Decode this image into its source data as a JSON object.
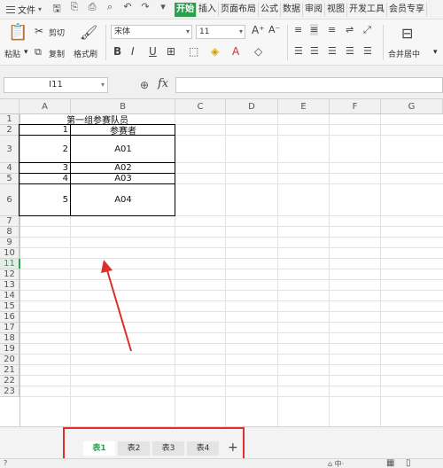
{
  "menubar": {
    "file_label": "文件",
    "tabs": [
      "开始",
      "插入",
      "页面布局",
      "公式",
      "数据",
      "审阅",
      "视图",
      "开发工具",
      "会员专享"
    ],
    "active_tab": "开始"
  },
  "ribbon": {
    "paste": "粘贴",
    "cut": "剪切",
    "copy": "复制",
    "format_painter": "格式刷",
    "font_name": "宋体",
    "font_size": "11",
    "merge_center": "合并居中"
  },
  "formula_bar": {
    "cell_ref": "I11",
    "fx": "fx",
    "formula": ""
  },
  "grid": {
    "columns": [
      "A",
      "B",
      "C",
      "D",
      "E",
      "F",
      "G"
    ],
    "rows": [
      "1",
      "2",
      "3",
      "4",
      "5",
      "6",
      "7",
      "8",
      "9",
      "10",
      "11",
      "12",
      "13",
      "14",
      "15",
      "16",
      "17",
      "18",
      "19",
      "20",
      "21",
      "22",
      "23"
    ],
    "selected_row": "11",
    "title": "第一组参赛队员",
    "header_participant": "参赛者",
    "entries": [
      {
        "index": "1",
        "name": ""
      },
      {
        "index": "2",
        "name": "A01"
      },
      {
        "index": "3",
        "name": "A02"
      },
      {
        "index": "4",
        "name": "A03"
      },
      {
        "index": "5",
        "name": "A04"
      }
    ]
  },
  "sheets": {
    "tabs": [
      "表1",
      "表2",
      "表3",
      "表4"
    ],
    "active": "表1",
    "add": "+"
  },
  "statusbar": {
    "left": "?"
  },
  "colors": {
    "accent": "#2e9e4f",
    "annotation": "#d9302a"
  }
}
